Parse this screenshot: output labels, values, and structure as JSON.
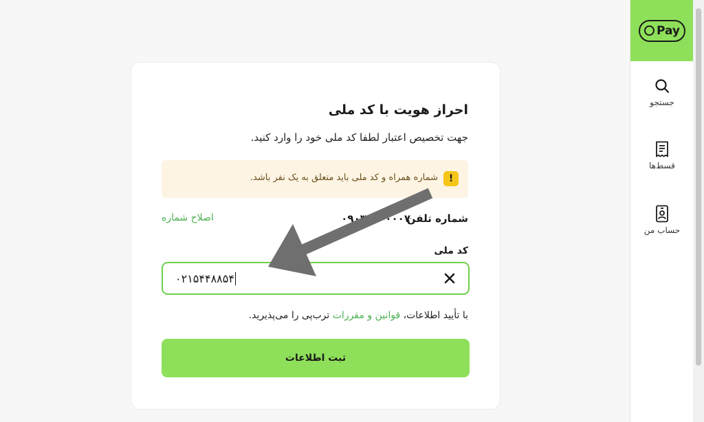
{
  "brand": {
    "logo_text": "Pay",
    "accent": "#8ee05a"
  },
  "sidebar": {
    "items": [
      {
        "label": "جستجو",
        "icon": "search-icon"
      },
      {
        "label": "قسط‌ها",
        "icon": "receipt-icon"
      },
      {
        "label": "حساب من",
        "icon": "profile-card-icon"
      }
    ]
  },
  "form": {
    "title": "احراز هویت با کد ملی",
    "subtitle": "جهت تخصیص اعتبار لطفا کد ملی خود را وارد کنید.",
    "warning": "شماره همراه و کد ملی باید متعلق به یک نفر باشد.",
    "phone_label": "شماره تلفن",
    "phone_value": "۰۹۰۳۵۰۰۰۰۰۷",
    "edit_phone": "اصلاح شماره",
    "nid_label": "کد ملی",
    "nid_value": "۰۲۱۵۴۴۸۸۵۴",
    "terms_prefix": "با تأیید اطلاعات،",
    "terms_link": "قوانین و مقررات",
    "terms_suffix": "ترب‌پی را می‌پذیرید.",
    "submit_label": "ثبت اطلاعات"
  }
}
